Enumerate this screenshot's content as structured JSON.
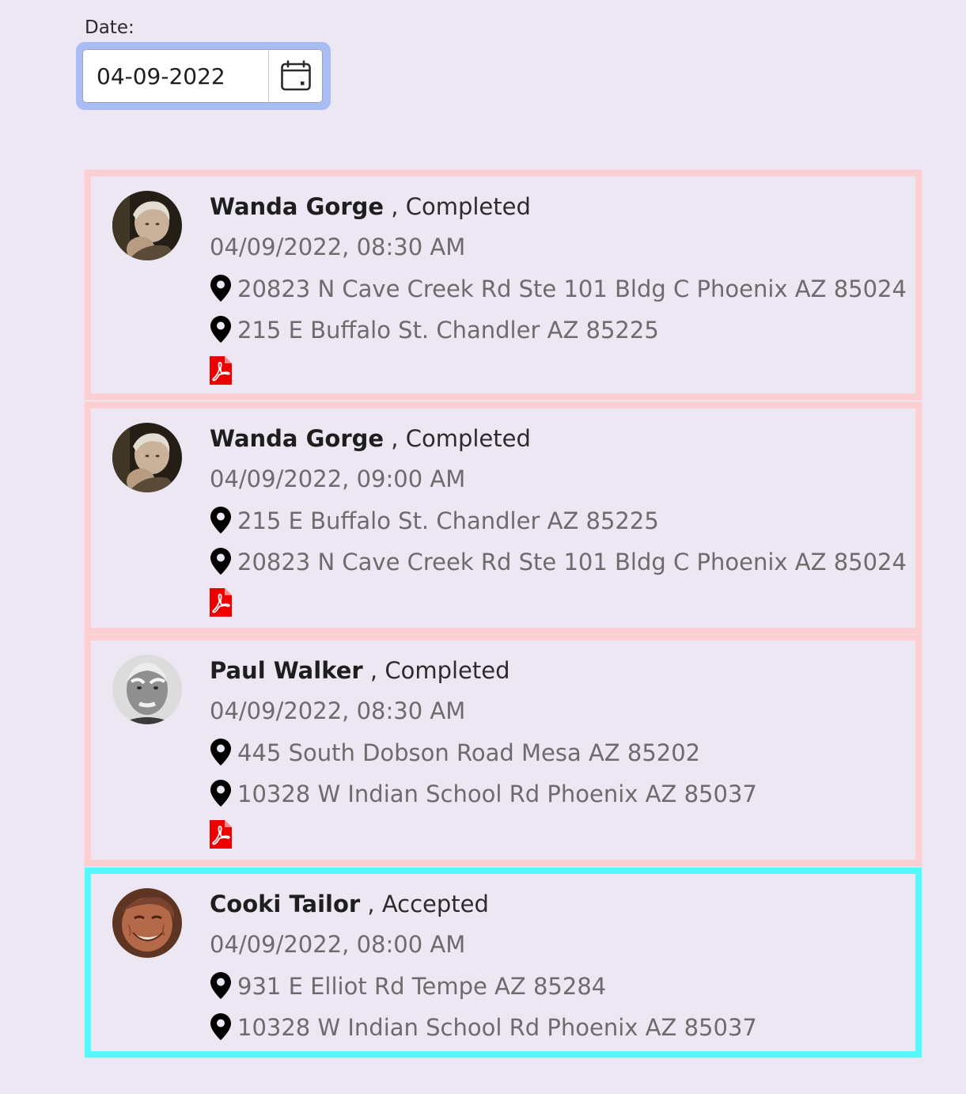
{
  "date": {
    "label": "Date:",
    "value": "04-09-2022"
  },
  "appointments": [
    {
      "name": "Wanda Gorge",
      "status": ", Completed",
      "datetime": "04/09/2022, 08:30 AM",
      "pickup": "20823 N Cave Creek Rd Ste 101 Bldg C Phoenix AZ 85024",
      "dropoff": "215 E Buffalo St. Chandler AZ 85225",
      "has_pdf": true,
      "state": "completed"
    },
    {
      "name": "Wanda Gorge",
      "status": ", Completed",
      "datetime": "04/09/2022, 09:00 AM",
      "pickup": "215 E Buffalo St. Chandler AZ 85225",
      "dropoff": "20823 N Cave Creek Rd Ste 101 Bldg C Phoenix AZ 85024",
      "has_pdf": true,
      "state": "completed"
    },
    {
      "name": "Paul Walker",
      "status": ", Completed",
      "datetime": "04/09/2022, 08:30 AM",
      "pickup": "445 South Dobson Road Mesa AZ 85202",
      "dropoff": "10328 W Indian School Rd Phoenix AZ 85037",
      "has_pdf": true,
      "state": "completed"
    },
    {
      "name": "Cooki Tailor",
      "status": ", Accepted",
      "datetime": "04/09/2022, 08:00 AM",
      "pickup": "931 E Elliot Rd Tempe AZ 85284",
      "dropoff": "10328 W Indian School Rd Phoenix AZ 85037",
      "has_pdf": false,
      "state": "accepted"
    }
  ],
  "colors": {
    "background": "#ede6f3",
    "completed_border": "#fccfd3",
    "accepted_border": "#55f9fb",
    "pdf_icon": "#ee0000",
    "date_focus_ring": "#a9bdf5"
  }
}
